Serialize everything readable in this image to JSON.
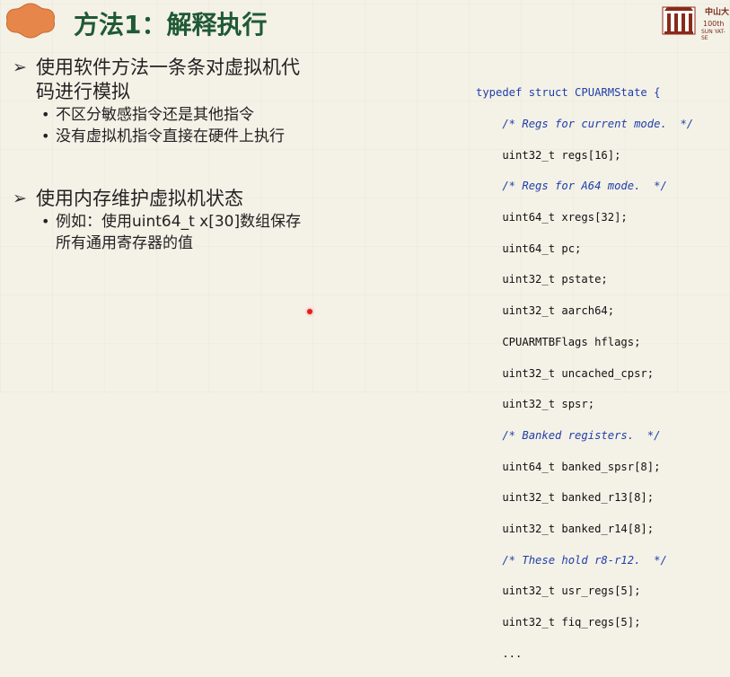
{
  "title": "方法1：解释执行",
  "logo": {
    "name_cn": "中山大",
    "year_text": "100th",
    "name_en": "SUN YAT-SE"
  },
  "left": {
    "bullet1": "使用软件方法一条条对虚拟机代码进行模拟",
    "bullet1_line1": "使用软件方法一条条对虚拟机代",
    "bullet1_line2": "码进行模拟",
    "sub1": "不区分敏感指令还是其他指令",
    "sub2": "没有虚拟机指令直接在硬件上执行",
    "bullet2": "使用内存维护虚拟机状态",
    "sub3_line1": "例如：使用uint64_t x[30]数组保存",
    "sub3_line2": "所有通用寄存器的值"
  },
  "code": {
    "l01": "typedef struct CPUARMState {",
    "l02": "    /* Regs for current mode.  */",
    "l03": "    uint32_t regs[16];",
    "l04": "    /* Regs for A64 mode.  */",
    "l05": "    uint64_t xregs[32];",
    "l06": "    uint64_t pc;",
    "l07": "    uint32_t pstate;",
    "l08": "    uint32_t aarch64;",
    "l09": "    CPUARMTBFlags hflags;",
    "l10": "    uint32_t uncached_cpsr;",
    "l11": "    uint32_t spsr;",
    "l12": "    /* Banked registers.  */",
    "l13": "    uint64_t banked_spsr[8];",
    "l14": "    uint32_t banked_r13[8];",
    "l15": "    uint32_t banked_r14[8];",
    "l16": "    /* These hold r8-r12.  */",
    "l17": "    uint32_t usr_regs[5];",
    "l18": "    uint32_t fiq_regs[5];",
    "l19": "    ..."
  },
  "icons": {
    "title_emblem": "ornate-emblem-icon",
    "bullet_arrow": "arrow-bullet-icon",
    "logo": "university-gate-logo-icon",
    "cursor": "red-laser-pointer-dot"
  },
  "colors": {
    "title": "#1f5a36",
    "emblem": "#e7864a",
    "code_keyword": "#1f3fa8",
    "laser": "#e02020"
  }
}
